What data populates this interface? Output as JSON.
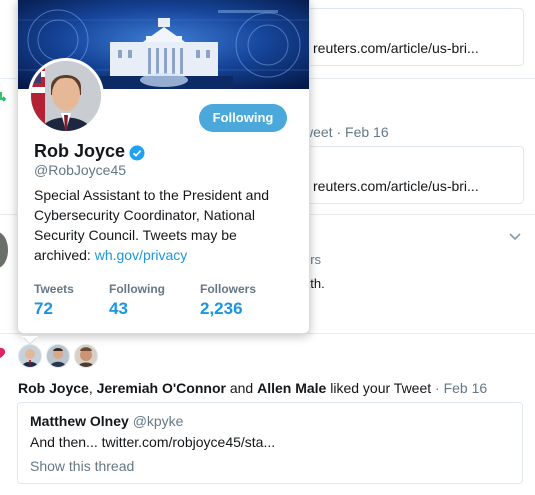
{
  "top_link_card": {
    "url": "reuters.com/article/us-bri..."
  },
  "retweet_row": {
    "meta": "weet · Feb 16"
  },
  "second_link_card": {
    "url": "reuters.com/article/us-bri..."
  },
  "partial_item": {
    "line1": "ers",
    "line2": "ath."
  },
  "popup": {
    "name": "Rob Joyce",
    "handle": "@RobJoyce45",
    "follow_label": "Following",
    "bio_text": "Special Assistant to the President and Cybersecurity Coordinator, National Security Council. Tweets may be archived:",
    "bio_link": "wh.gov/privacy",
    "stats": [
      {
        "label": "Tweets",
        "value": "72"
      },
      {
        "label": "Following",
        "value": "43"
      },
      {
        "label": "Followers",
        "value": "2,236"
      }
    ]
  },
  "notification": {
    "liker1": "Rob Joyce",
    "sep1": ",",
    "liker2": "Jeremiah O'Connor",
    "and_text": "and",
    "liker3": "Allen Male",
    "action_text": "liked your Tweet",
    "time": "· Feb 16"
  },
  "quoted_tweet": {
    "author": "Matthew Olney",
    "handle": "@kpyke",
    "text": "And then... twitter.com/robjoyce45/sta...",
    "show_thread": "Show this thread"
  },
  "colors": {
    "accent": "#1b95e0",
    "follow_btn": "#4aa9da",
    "like": "#e0245e",
    "retweet": "#17bf63"
  }
}
